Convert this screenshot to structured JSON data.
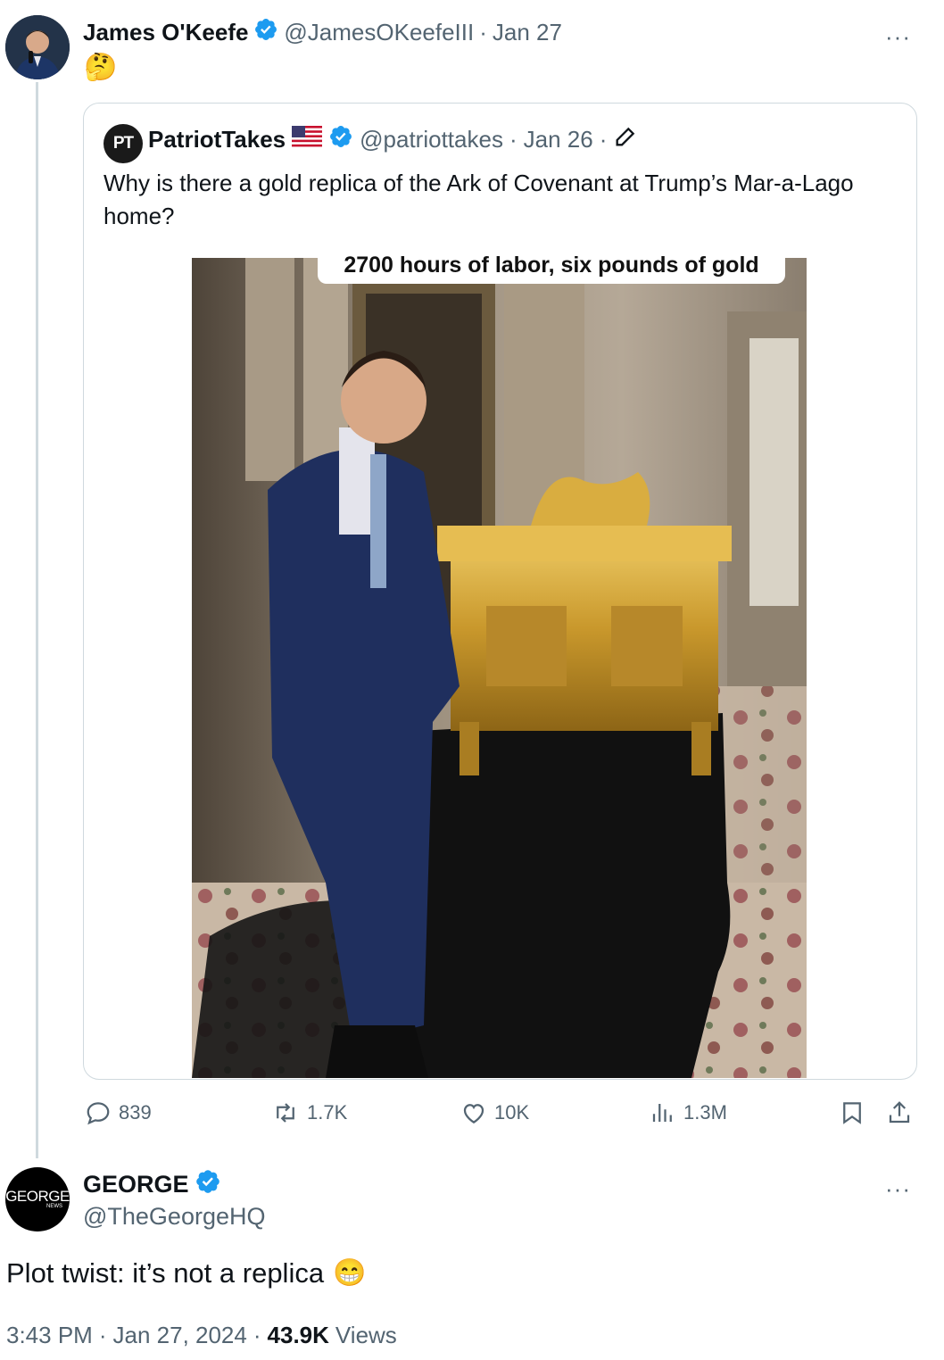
{
  "main_tweet": {
    "author_name": "James O'Keefe",
    "handle": "@JamesOKeefeIII",
    "sep": "·",
    "date": "Jan 27",
    "text": "🤔",
    "more": "···"
  },
  "quoted_tweet": {
    "avatar_text": "PT",
    "author_name": "PatriotTakes",
    "flag": "🇺🇸",
    "handle": "@patriottakes",
    "sep": "·",
    "date": "Jan 26",
    "sep2": "·",
    "text": "Why is there a gold replica of the Ark of Covenant at Trump’s Mar-a-Lago home?",
    "image_caption": "2700 hours of labor, six pounds of gold"
  },
  "actions": {
    "replies": "839",
    "reposts": "1.7K",
    "likes": "10K",
    "views": "1.3M"
  },
  "reply_tweet": {
    "avatar_text": "GEORGE",
    "avatar_sub": "NEWS",
    "author_name": "GEORGE",
    "handle": "@TheGeorgeHQ",
    "text": "Plot twist: it’s not a replica",
    "emoji": "😁",
    "more": "···",
    "time": "3:43 PM",
    "sep": "·",
    "date": "Jan 27, 2024",
    "sep2": "·",
    "views_count": "43.9K",
    "views_label": "Views"
  },
  "colors": {
    "verified": "#1d9bf0",
    "muted": "#536471",
    "border": "#cfd9de",
    "text": "#0f1419"
  },
  "icons": [
    "verified-badge-icon",
    "more-icon",
    "reply-icon",
    "repost-icon",
    "like-icon",
    "views-icon",
    "bookmark-icon",
    "share-icon",
    "pencil-icon",
    "flag-icon"
  ]
}
